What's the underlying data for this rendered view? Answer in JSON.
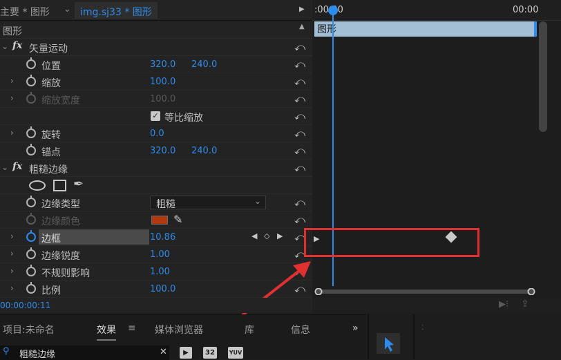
{
  "header": {
    "tab_main": "主要 * 图形",
    "tab_active": "img.sj33 * 图形",
    "chevron": "⌄",
    "play_icon": "▶"
  },
  "timeline": {
    "time_start": ":00:00",
    "time_end": "00:00",
    "clip_label": "图形",
    "current_time": "00:00:00:11"
  },
  "panel": {
    "section_label": "图形",
    "vector_motion": {
      "title": "矢量运动",
      "position_label": "位置",
      "position_x": "320.0",
      "position_y": "240.0",
      "scale_label": "缩放",
      "scale_value": "100.0",
      "scale_width_label": "缩放宽度",
      "scale_width_value": "100.0",
      "uniform_scale_label": "等比缩放",
      "rotation_label": "旋转",
      "rotation_value": "0.0",
      "anchor_label": "锚点",
      "anchor_x": "320.0",
      "anchor_y": "240.0"
    },
    "rough_edges": {
      "title": "粗糙边缘",
      "edge_type_label": "边缘类型",
      "edge_type_value": "粗糙",
      "edge_color_label": "边缘颜色",
      "edge_color_swatch": "#b33a0e",
      "border_label": "边框",
      "border_value": "10.86",
      "edge_sharpness_label": "边缘锐度",
      "edge_sharpness_value": "1.00",
      "irregular_label": "不规则影响",
      "irregular_value": "1.00",
      "scale_label": "比例",
      "scale_value": "100.0"
    },
    "reset_icon": "⤺"
  },
  "bottom": {
    "tab_project": "项目:未命名",
    "tab_effects": "效果",
    "tab_effects_menu": "≡",
    "tab_media": "媒体浏览器",
    "tab_library": "库",
    "tab_info": "信息",
    "more": "»",
    "search_value": "粗糙边缘",
    "search_clear": "✕",
    "icon_32": "32",
    "icon_yuv": "YUV",
    "icon_accel": "▶"
  },
  "colors": {
    "accent": "#2d8ceb",
    "highlight": "#e03030"
  }
}
